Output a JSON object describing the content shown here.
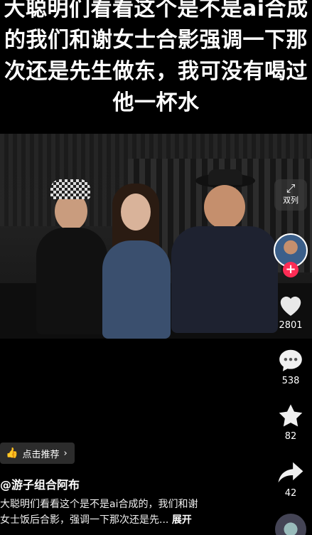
{
  "caption": {
    "lines": [
      "大聪明们看看这个是不是ai合成",
      "的我们和谢女士合影强调一下那",
      "次还是先生做东，我可没有喝过",
      "他一杯水"
    ]
  },
  "side": {
    "dual_label": "双列",
    "likes": "2801",
    "comments": "538",
    "favorites": "82",
    "shares": "42"
  },
  "bottom": {
    "recommend_label": "点击推荐",
    "author": "@游子组合阿布",
    "description_line1": "大聪明们看看这个是不是ai合成的，我们和谢",
    "description_line2": "女士饭后合影，强调一下那次还是先...",
    "expand_label": "展开"
  },
  "colors": {
    "follow_plus": "#fe2c55",
    "background": "#000000"
  }
}
